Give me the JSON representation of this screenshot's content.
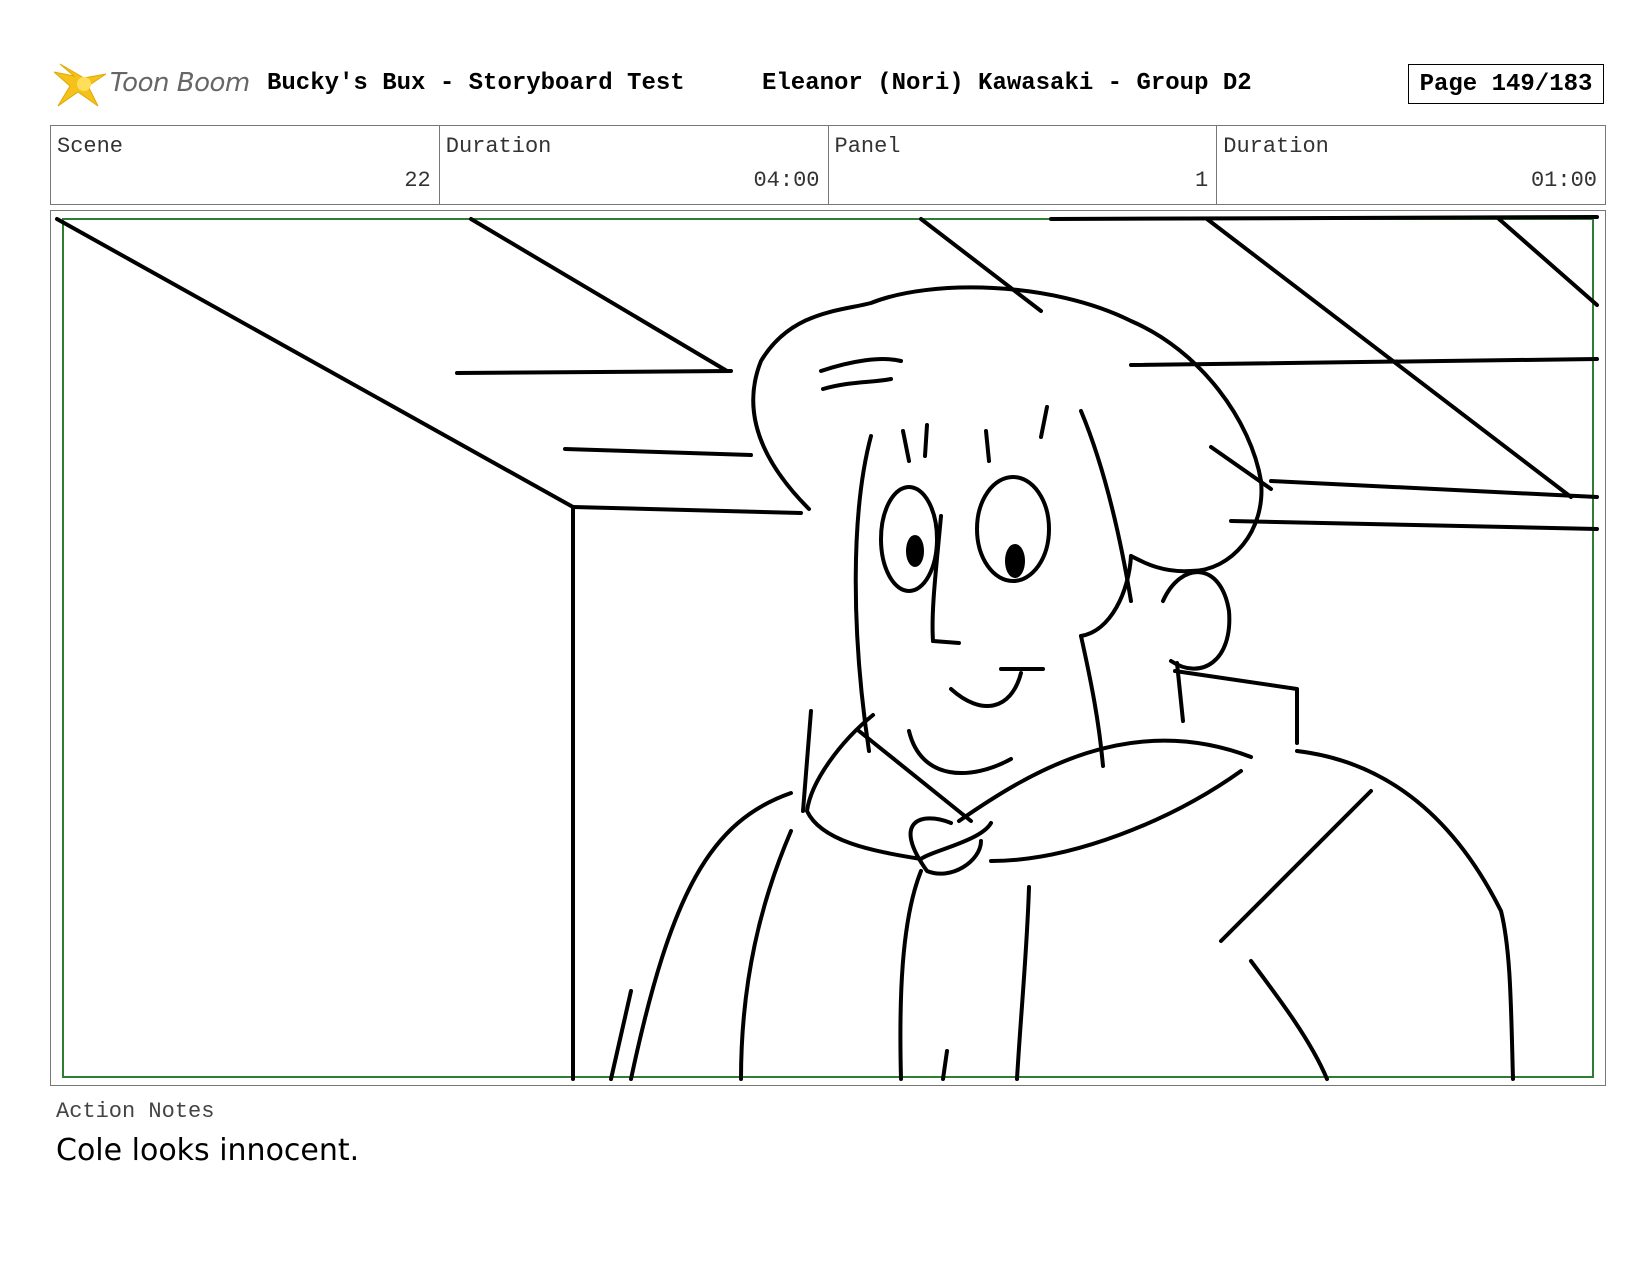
{
  "header": {
    "logo_text": "Toon Boom",
    "project_title": "Bucky's Bux - Storyboard Test",
    "artist": "Eleanor (Nori) Kawasaki - Group D2",
    "page": "Page 149/183"
  },
  "info": {
    "scene_label": "Scene",
    "scene_value": "22",
    "scene_duration_label": "Duration",
    "scene_duration_value": "04:00",
    "panel_label": "Panel",
    "panel_value": "1",
    "panel_duration_label": "Duration",
    "panel_duration_value": "01:00"
  },
  "notes": {
    "label": "Action Notes",
    "text": "Cole looks innocent."
  },
  "colors": {
    "safe_frame": "#2e7d32",
    "logo_star": "#f5c21b"
  }
}
